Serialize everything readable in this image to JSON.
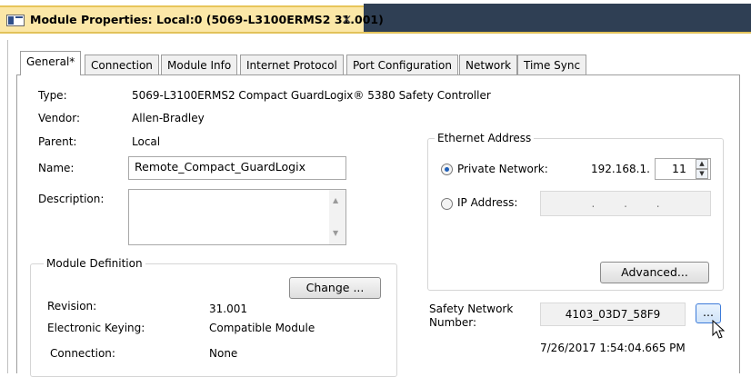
{
  "window": {
    "title": "Module Properties: Local:0 (5069-L3100ERMS2 31.001)",
    "close_glyph": "×"
  },
  "tabs": [
    {
      "label": "General*",
      "active": true
    },
    {
      "label": "Connection"
    },
    {
      "label": "Module Info"
    },
    {
      "label": "Internet Protocol"
    },
    {
      "label": "Port Configuration"
    },
    {
      "label": "Network"
    },
    {
      "label": "Time Sync"
    }
  ],
  "general": {
    "type_label": "Type:",
    "type_value": "5069-L3100ERMS2 Compact GuardLogix® 5380 Safety Controller",
    "vendor_label": "Vendor:",
    "vendor_value": "Allen-Bradley",
    "parent_label": "Parent:",
    "parent_value": "Local",
    "name_label": "Name:",
    "name_value": "Remote_Compact_GuardLogix",
    "description_label": "Description:",
    "description_value": ""
  },
  "module_definition": {
    "title": "Module Definition",
    "change_button": "Change ...",
    "revision_label": "Revision:",
    "revision_value": "31.001",
    "keying_label": "Electronic Keying:",
    "keying_value": "Compatible Module",
    "connection_label": "Connection:",
    "connection_value": "None"
  },
  "ethernet": {
    "title": "Ethernet Address",
    "private_network_label": "Private Network:",
    "private_network_prefix": "192.168.1.",
    "private_network_value": "11",
    "ip_address_label": "IP Address:",
    "ip_dots": ". . .",
    "advanced_button": "Advanced...",
    "private_selected": true
  },
  "safety": {
    "label_line1": "Safety Network",
    "label_line2": "Number:",
    "value": "4103_03D7_58F9",
    "browse_button": "...",
    "timestamp": "7/26/2017 1:54:04.665 PM"
  },
  "icons": [
    "window-icon",
    "close-icon",
    "scroll-up-icon",
    "scroll-down-icon",
    "spin-up-icon",
    "spin-down-icon",
    "mouse-cursor-icon"
  ]
}
